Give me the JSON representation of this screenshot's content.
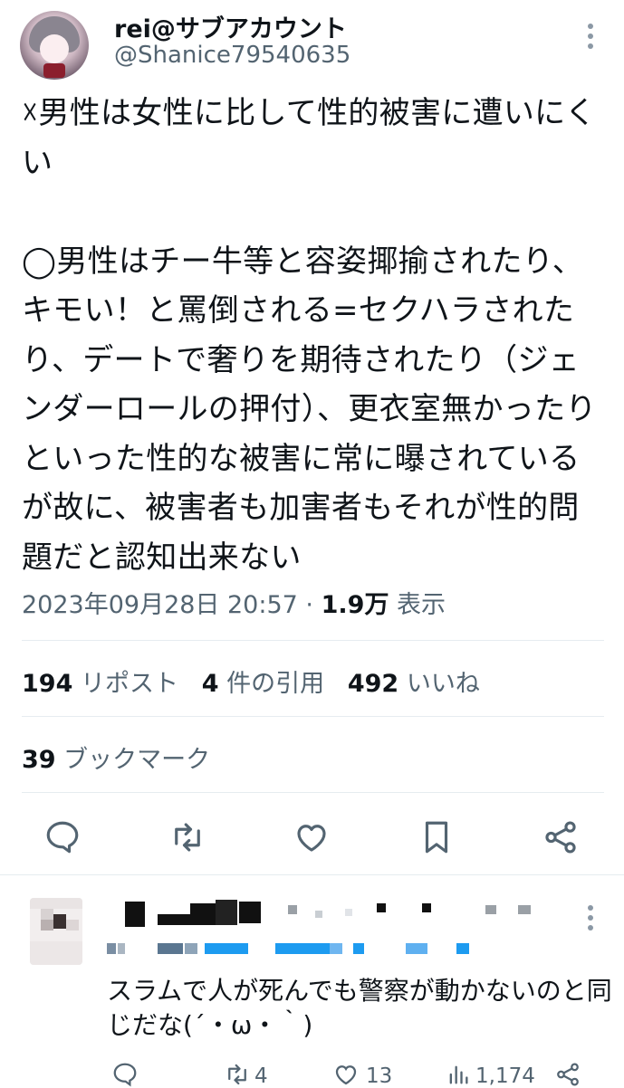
{
  "tweet": {
    "display_name": "rei@サブアカウント",
    "handle": "@Shanice79540635",
    "text": "☓男性は女性に比して性的被害に遭いにくい\n\n◯男性はチー牛等と容姿揶揄されたり、キモい！と罵倒される=セクハラされたり、デートで奢りを期待されたり（ジェンダーロールの押付）、更衣室無かったりといった性的な被害に常に曝されているが故に、被害者も加害者もそれが性的問題だと認知出来ない",
    "timestamp": "2023年09月28日 20:57",
    "separator": "·",
    "views_count": "1.9万",
    "views_label": "表示",
    "reposts_count": "194",
    "reposts_label": "リポスト",
    "quotes_count": "4",
    "quotes_label": "件の引用",
    "likes_count": "492",
    "likes_label": "いいね",
    "bookmarks_count": "39",
    "bookmarks_label": "ブックマーク"
  },
  "actions": {
    "icons": [
      "reply-icon",
      "repost-icon",
      "like-icon",
      "bookmark-icon",
      "share-icon"
    ]
  },
  "reply": {
    "text": "スラムで人が死んでも警察が動かないのと同じだな(´・ω・｀)",
    "retweets": "4",
    "likes": "13",
    "views": "1,174"
  },
  "colors": {
    "text": "#0f1419",
    "secondary": "#536471",
    "divider": "#e6ecf0",
    "icon": "#536471",
    "redaction_blue": "#1d9bf0"
  }
}
